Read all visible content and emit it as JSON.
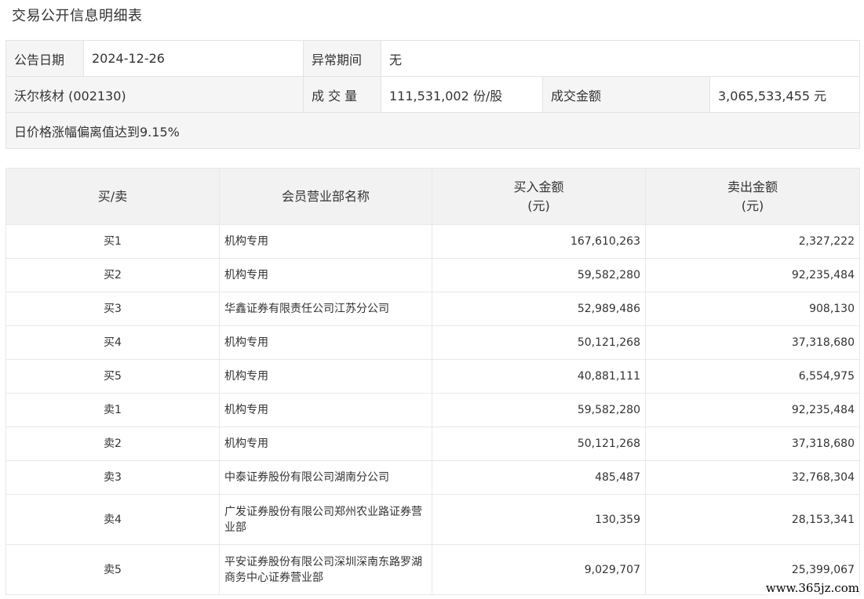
{
  "page": {
    "title": "交易公开信息明细表"
  },
  "info": {
    "announce_date_label": "公告日期",
    "announce_date_value": "2024-12-26",
    "abnormal_period_label": "异常期间",
    "abnormal_period_value": "无",
    "stock_name": "沃尔核材 (002130)",
    "volume_label": "成 交 量",
    "volume_value": "111,531,002 份/股",
    "amount_label": "成交金额",
    "amount_value": "3,065,533,455 元",
    "reason": "日价格涨幅偏离值达到9.15%"
  },
  "detail": {
    "headers": {
      "side": "买/卖",
      "branch": "会员营业部名称",
      "buy_line1": "买入金额",
      "buy_line2": "(元)",
      "sell_line1": "卖出金额",
      "sell_line2": "(元)"
    },
    "rows": [
      {
        "side": "买1",
        "branch": "机构专用",
        "buy": "167,610,263",
        "sell": "2,327,222"
      },
      {
        "side": "买2",
        "branch": "机构专用",
        "buy": "59,582,280",
        "sell": "92,235,484"
      },
      {
        "side": "买3",
        "branch": "华鑫证券有限责任公司江苏分公司",
        "buy": "52,989,486",
        "sell": "908,130"
      },
      {
        "side": "买4",
        "branch": "机构专用",
        "buy": "50,121,268",
        "sell": "37,318,680"
      },
      {
        "side": "买5",
        "branch": "机构专用",
        "buy": "40,881,111",
        "sell": "6,554,975"
      },
      {
        "side": "卖1",
        "branch": "机构专用",
        "buy": "59,582,280",
        "sell": "92,235,484"
      },
      {
        "side": "卖2",
        "branch": "机构专用",
        "buy": "50,121,268",
        "sell": "37,318,680"
      },
      {
        "side": "卖3",
        "branch": "中泰证券股份有限公司湖南分公司",
        "buy": "485,487",
        "sell": "32,768,304"
      },
      {
        "side": "卖4",
        "branch": "广发证券股份有限公司郑州农业路证券营业部",
        "buy": "130,359",
        "sell": "28,153,341"
      },
      {
        "side": "卖5",
        "branch": "平安证券股份有限公司深圳深南东路罗湖商务中心证券营业部",
        "buy": "9,029,707",
        "sell": "25,399,067"
      }
    ]
  },
  "watermark": "www.365jz.com"
}
